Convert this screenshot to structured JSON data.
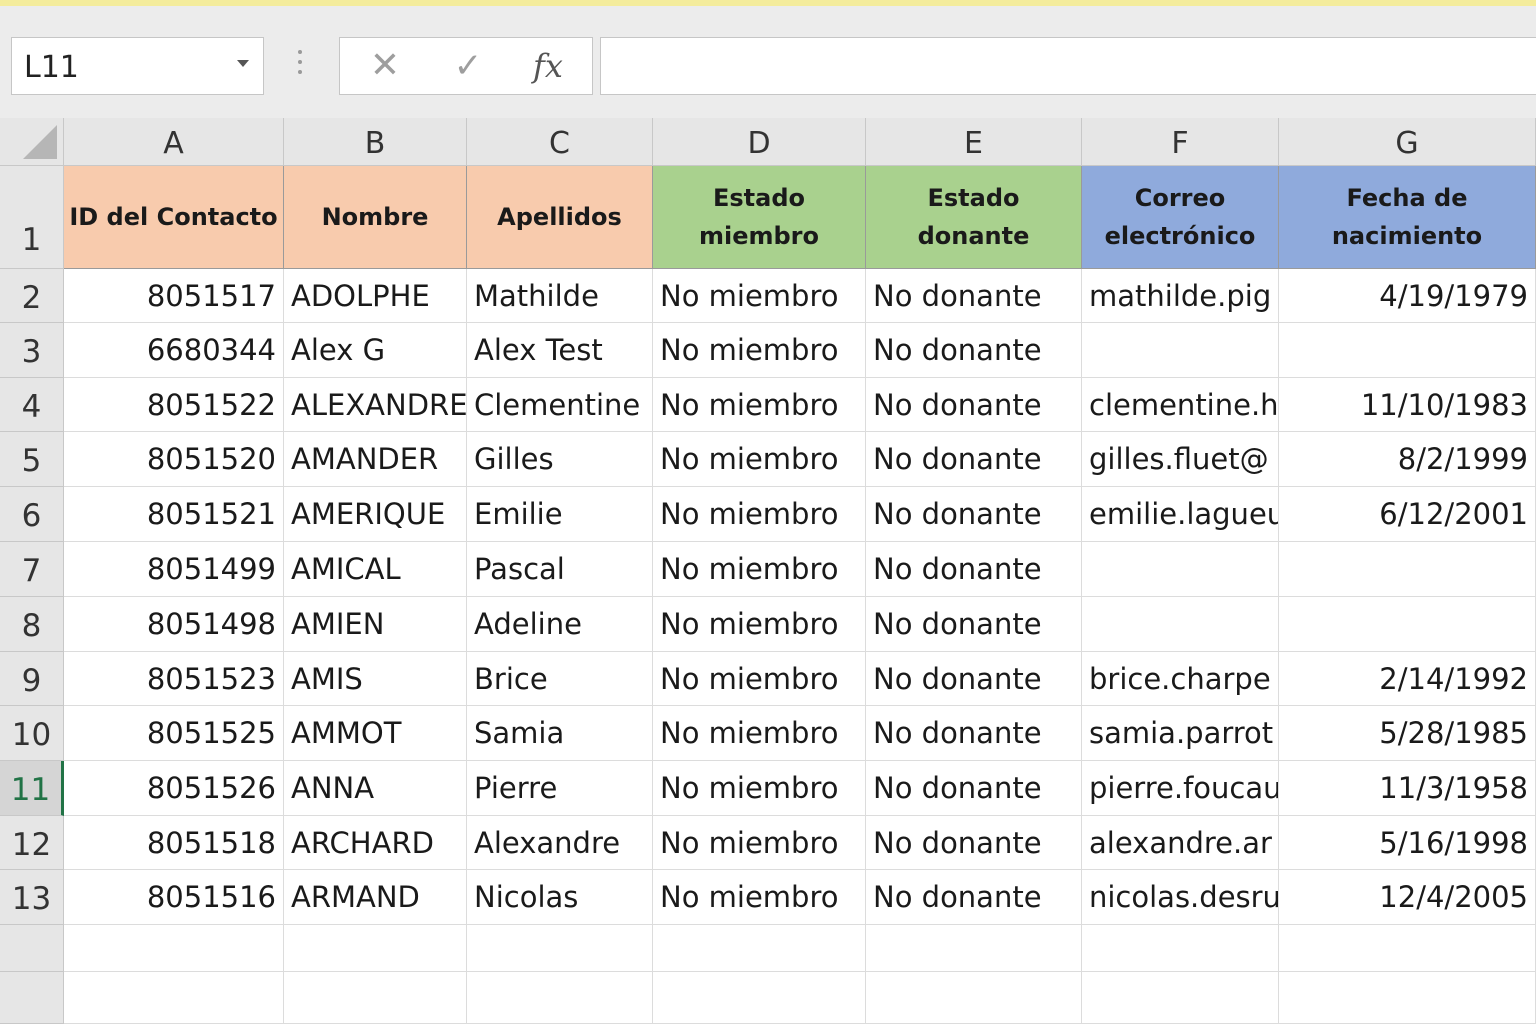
{
  "namebox": {
    "value": "L11"
  },
  "formula_bar": {
    "cancel_glyph": "✕",
    "enter_glyph": "✓",
    "fx_label": "fx",
    "value": ""
  },
  "columns": [
    "A",
    "B",
    "C",
    "D",
    "E",
    "F",
    "G"
  ],
  "row_numbers": [
    "1",
    "2",
    "3",
    "4",
    "5",
    "6",
    "7",
    "8",
    "9",
    "10",
    "11",
    "12",
    "13"
  ],
  "active_row": "11",
  "colors": {
    "header_orange": "#f8cbad",
    "header_green": "#a9d18e",
    "header_blue": "#8faadc",
    "accent": "#217346"
  },
  "table": {
    "headers": [
      "ID del Contacto",
      "Nombre",
      "Apellidos",
      "Estado miembro",
      "Estado donante",
      "Correo electrónico",
      "Fecha de nacimiento"
    ],
    "rows": [
      [
        "8051517",
        "ADOLPHE",
        "Mathilde",
        "No miembro",
        "No donante",
        "mathilde.pig",
        "4/19/1979"
      ],
      [
        "6680344",
        "Alex G",
        "Alex Test",
        "No miembro",
        "No donante",
        "",
        ""
      ],
      [
        "8051522",
        "ALEXANDRE",
        "Clementine",
        "No miembro",
        "No donante",
        "clementine.h",
        "11/10/1983"
      ],
      [
        "8051520",
        "AMANDER",
        "Gilles",
        "No miembro",
        "No donante",
        "gilles.fluet@",
        "8/2/1999"
      ],
      [
        "8051521",
        "AMERIQUE",
        "Emilie",
        "No miembro",
        "No donante",
        "emilie.lagueu",
        "6/12/2001"
      ],
      [
        "8051499",
        "AMICAL",
        "Pascal",
        "No miembro",
        "No donante",
        "",
        ""
      ],
      [
        "8051498",
        "AMIEN",
        "Adeline",
        "No miembro",
        "No donante",
        "",
        ""
      ],
      [
        "8051523",
        "AMIS",
        "Brice",
        "No miembro",
        "No donante",
        "brice.charpe",
        "2/14/1992"
      ],
      [
        "8051525",
        "AMMOT",
        "Samia",
        "No miembro",
        "No donante",
        "samia.parrot",
        "5/28/1985"
      ],
      [
        "8051526",
        "ANNA",
        "Pierre",
        "No miembro",
        "No donante",
        "pierre.foucau",
        "11/3/1958"
      ],
      [
        "8051518",
        "ARCHARD",
        "Alexandre",
        "No miembro",
        "No donante",
        "alexandre.ar",
        "5/16/1998"
      ],
      [
        "8051516",
        "ARMAND",
        "Nicolas",
        "No miembro",
        "No donante",
        "nicolas.desru",
        "12/4/2005"
      ]
    ]
  }
}
